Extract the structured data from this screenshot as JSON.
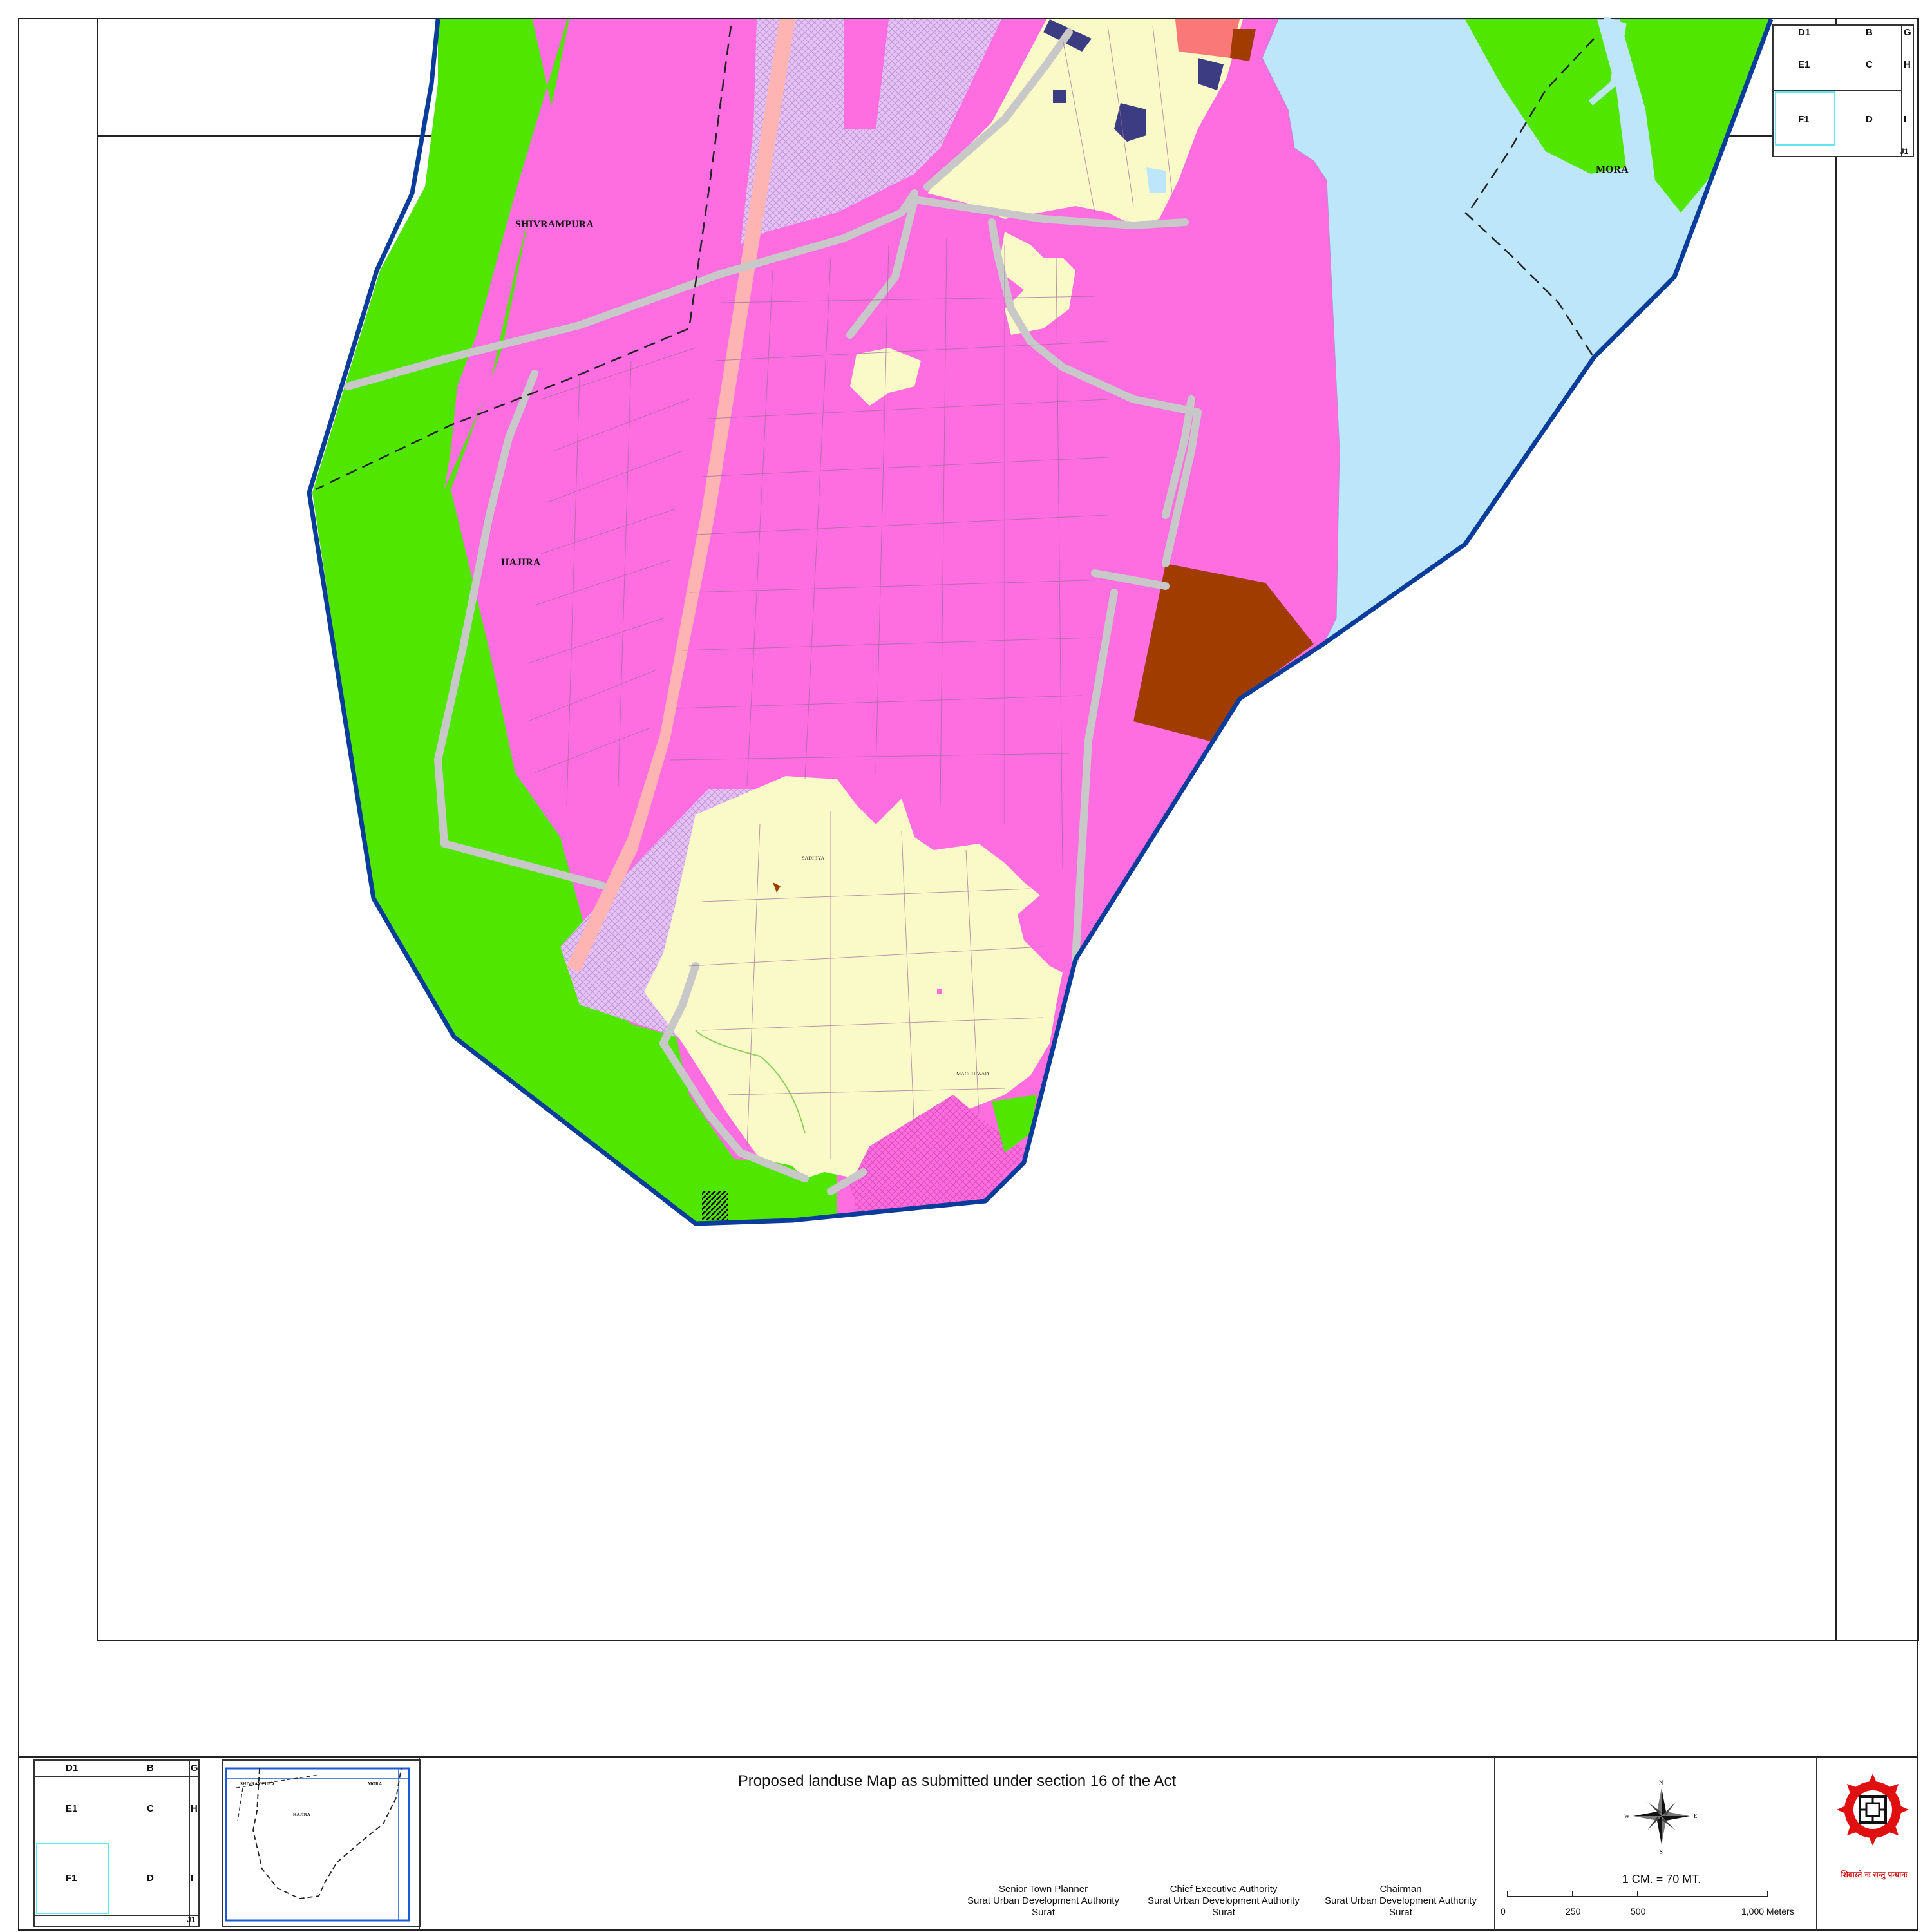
{
  "map": {
    "place_labels": [
      "SHIVRAMPURA",
      "HAJIRA",
      "MORA"
    ],
    "settlement_labels": [
      "SADHIYA",
      "MACCHIWAD"
    ],
    "colors": {
      "agriculture_green": "#50e600",
      "industrial_magenta": "#ff6ee0",
      "residential_yellow": "#fafac8",
      "water_blue": "#bee6fa",
      "special_lavender": "#e6c3f5",
      "public_brown": "#a03c00",
      "civic_navy": "#3c3c82",
      "commercial_salmon": "#fa7878",
      "boundary_blue": "#0a3c9b",
      "road_grey": "#c8c8c8",
      "rail_pink": "#ffb4b4"
    }
  },
  "key_index": {
    "header": [
      "D1",
      "B",
      "G"
    ],
    "rows": [
      [
        "E1",
        "C",
        "H"
      ],
      [
        "F1",
        "D",
        "I"
      ]
    ],
    "footer": "J1",
    "highlighted": "F1"
  },
  "inset_map": {
    "labels": [
      "SHIVRAMPURA",
      "MORA",
      "HAJIRA"
    ]
  },
  "title_block": {
    "title": "Proposed landuse Map as submitted under section 16 of the Act",
    "signatories": [
      {
        "role": "Senior Town Planner",
        "org": "Surat Urban Development Authority",
        "city": "Surat"
      },
      {
        "role": "Chief Executive Authority",
        "org": "Surat Urban Development Authority",
        "city": "Surat"
      },
      {
        "role": "Chairman",
        "org": "Surat Urban Development Authority",
        "city": "Surat"
      }
    ]
  },
  "scale": {
    "ratio_text": "1 CM. = 70 MT.",
    "ticks": [
      "0",
      "250",
      "500",
      "1,000 Meters"
    ],
    "tick_values": [
      0,
      250,
      500,
      1000
    ]
  },
  "compass": {
    "n": "N",
    "s": "S",
    "e": "E",
    "w": "W"
  },
  "logo": {
    "motto": "शिवास्ते नः सन्तु पन्थानः"
  }
}
